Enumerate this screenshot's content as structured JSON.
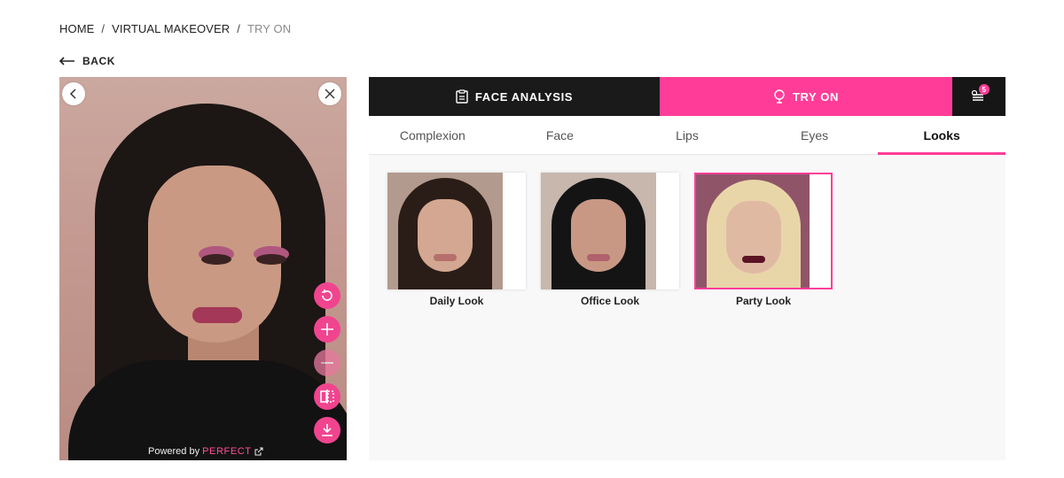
{
  "breadcrumb": {
    "items": [
      "HOME",
      "VIRTUAL MAKEOVER",
      "TRY ON"
    ],
    "separator": "/"
  },
  "back": {
    "label": "BACK"
  },
  "viewer": {
    "powered_by": "Powered by",
    "brand": "PERFECT",
    "tools": [
      "reset-icon",
      "zoom-in-icon",
      "zoom-out-icon",
      "compare-icon",
      "download-icon"
    ]
  },
  "topbar": {
    "face_analysis": "FACE ANALYSIS",
    "try_on": "TRY ON",
    "history_count": "5"
  },
  "tabs": [
    "Complexion",
    "Face",
    "Lips",
    "Eyes",
    "Looks"
  ],
  "active_tab": "Looks",
  "looks": [
    {
      "label": "Daily Look",
      "selected": false
    },
    {
      "label": "Office Look",
      "selected": false
    },
    {
      "label": "Party Look",
      "selected": true
    }
  ],
  "colors": {
    "accent": "#ff3d99",
    "dark": "#1a1a1a"
  }
}
